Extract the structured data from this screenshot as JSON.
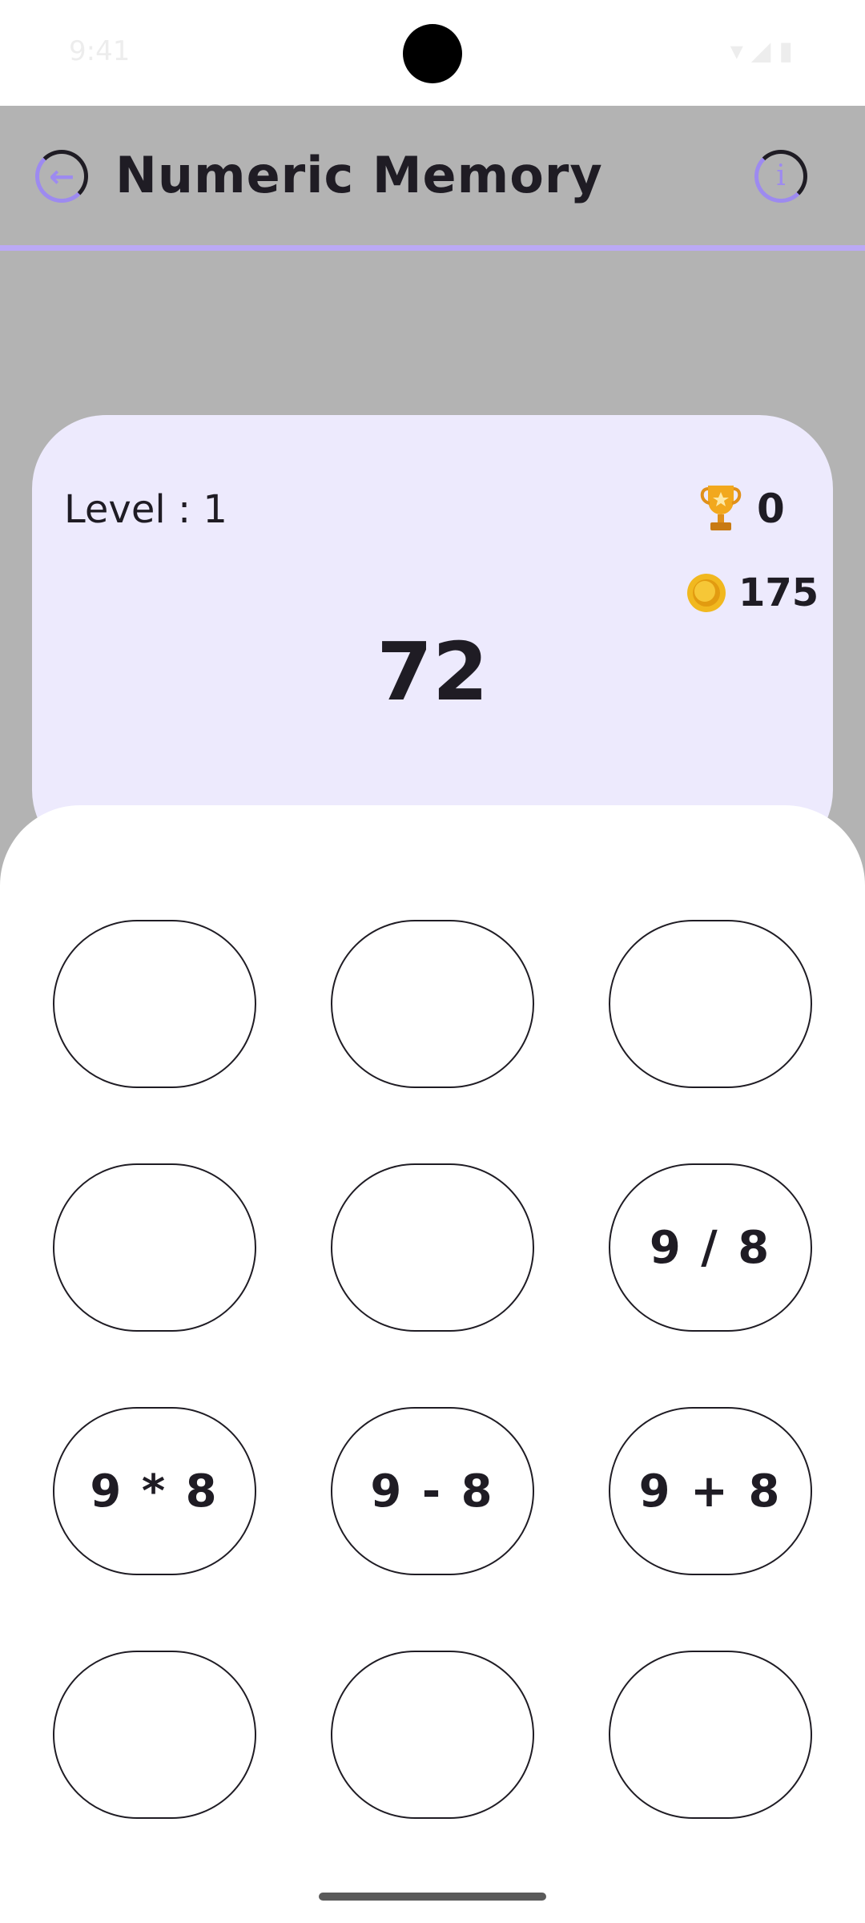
{
  "status_bar": {
    "time": "9:41",
    "icons": "▾◢▮"
  },
  "header": {
    "title": "Numeric Memory",
    "back_icon": "arrow-left-icon",
    "info_icon": "info-icon",
    "back_glyph": "←",
    "info_glyph": "i"
  },
  "colors": {
    "accent": "#9d8af0",
    "card_bg": "#edeafd",
    "overlay": "#b3b3b3",
    "text": "#1f1c24"
  },
  "game": {
    "level_label": "Level : 1",
    "trophies": "0",
    "coins": "175",
    "target": "72"
  },
  "tiles": [
    "",
    "",
    "",
    "",
    "",
    "9 / 8",
    "9 * 8",
    "9 - 8",
    "9 + 8",
    "",
    "",
    ""
  ]
}
